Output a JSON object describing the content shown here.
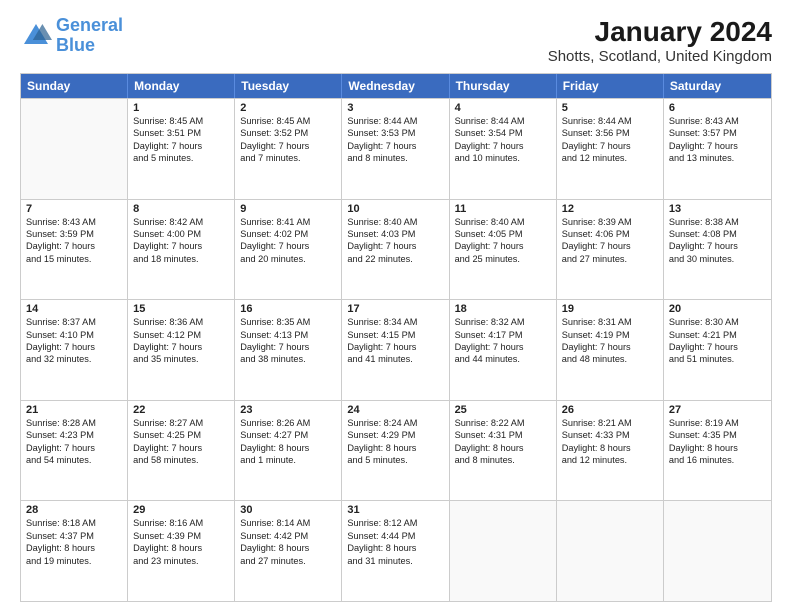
{
  "header": {
    "logo_general": "General",
    "logo_blue": "Blue",
    "main_title": "January 2024",
    "subtitle": "Shotts, Scotland, United Kingdom"
  },
  "days_of_week": [
    "Sunday",
    "Monday",
    "Tuesday",
    "Wednesday",
    "Thursday",
    "Friday",
    "Saturday"
  ],
  "weeks": [
    [
      {
        "day": "",
        "lines": []
      },
      {
        "day": "1",
        "lines": [
          "Sunrise: 8:45 AM",
          "Sunset: 3:51 PM",
          "Daylight: 7 hours",
          "and 5 minutes."
        ]
      },
      {
        "day": "2",
        "lines": [
          "Sunrise: 8:45 AM",
          "Sunset: 3:52 PM",
          "Daylight: 7 hours",
          "and 7 minutes."
        ]
      },
      {
        "day": "3",
        "lines": [
          "Sunrise: 8:44 AM",
          "Sunset: 3:53 PM",
          "Daylight: 7 hours",
          "and 8 minutes."
        ]
      },
      {
        "day": "4",
        "lines": [
          "Sunrise: 8:44 AM",
          "Sunset: 3:54 PM",
          "Daylight: 7 hours",
          "and 10 minutes."
        ]
      },
      {
        "day": "5",
        "lines": [
          "Sunrise: 8:44 AM",
          "Sunset: 3:56 PM",
          "Daylight: 7 hours",
          "and 12 minutes."
        ]
      },
      {
        "day": "6",
        "lines": [
          "Sunrise: 8:43 AM",
          "Sunset: 3:57 PM",
          "Daylight: 7 hours",
          "and 13 minutes."
        ]
      }
    ],
    [
      {
        "day": "7",
        "lines": [
          "Sunrise: 8:43 AM",
          "Sunset: 3:59 PM",
          "Daylight: 7 hours",
          "and 15 minutes."
        ]
      },
      {
        "day": "8",
        "lines": [
          "Sunrise: 8:42 AM",
          "Sunset: 4:00 PM",
          "Daylight: 7 hours",
          "and 18 minutes."
        ]
      },
      {
        "day": "9",
        "lines": [
          "Sunrise: 8:41 AM",
          "Sunset: 4:02 PM",
          "Daylight: 7 hours",
          "and 20 minutes."
        ]
      },
      {
        "day": "10",
        "lines": [
          "Sunrise: 8:40 AM",
          "Sunset: 4:03 PM",
          "Daylight: 7 hours",
          "and 22 minutes."
        ]
      },
      {
        "day": "11",
        "lines": [
          "Sunrise: 8:40 AM",
          "Sunset: 4:05 PM",
          "Daylight: 7 hours",
          "and 25 minutes."
        ]
      },
      {
        "day": "12",
        "lines": [
          "Sunrise: 8:39 AM",
          "Sunset: 4:06 PM",
          "Daylight: 7 hours",
          "and 27 minutes."
        ]
      },
      {
        "day": "13",
        "lines": [
          "Sunrise: 8:38 AM",
          "Sunset: 4:08 PM",
          "Daylight: 7 hours",
          "and 30 minutes."
        ]
      }
    ],
    [
      {
        "day": "14",
        "lines": [
          "Sunrise: 8:37 AM",
          "Sunset: 4:10 PM",
          "Daylight: 7 hours",
          "and 32 minutes."
        ]
      },
      {
        "day": "15",
        "lines": [
          "Sunrise: 8:36 AM",
          "Sunset: 4:12 PM",
          "Daylight: 7 hours",
          "and 35 minutes."
        ]
      },
      {
        "day": "16",
        "lines": [
          "Sunrise: 8:35 AM",
          "Sunset: 4:13 PM",
          "Daylight: 7 hours",
          "and 38 minutes."
        ]
      },
      {
        "day": "17",
        "lines": [
          "Sunrise: 8:34 AM",
          "Sunset: 4:15 PM",
          "Daylight: 7 hours",
          "and 41 minutes."
        ]
      },
      {
        "day": "18",
        "lines": [
          "Sunrise: 8:32 AM",
          "Sunset: 4:17 PM",
          "Daylight: 7 hours",
          "and 44 minutes."
        ]
      },
      {
        "day": "19",
        "lines": [
          "Sunrise: 8:31 AM",
          "Sunset: 4:19 PM",
          "Daylight: 7 hours",
          "and 48 minutes."
        ]
      },
      {
        "day": "20",
        "lines": [
          "Sunrise: 8:30 AM",
          "Sunset: 4:21 PM",
          "Daylight: 7 hours",
          "and 51 minutes."
        ]
      }
    ],
    [
      {
        "day": "21",
        "lines": [
          "Sunrise: 8:28 AM",
          "Sunset: 4:23 PM",
          "Daylight: 7 hours",
          "and 54 minutes."
        ]
      },
      {
        "day": "22",
        "lines": [
          "Sunrise: 8:27 AM",
          "Sunset: 4:25 PM",
          "Daylight: 7 hours",
          "and 58 minutes."
        ]
      },
      {
        "day": "23",
        "lines": [
          "Sunrise: 8:26 AM",
          "Sunset: 4:27 PM",
          "Daylight: 8 hours",
          "and 1 minute."
        ]
      },
      {
        "day": "24",
        "lines": [
          "Sunrise: 8:24 AM",
          "Sunset: 4:29 PM",
          "Daylight: 8 hours",
          "and 5 minutes."
        ]
      },
      {
        "day": "25",
        "lines": [
          "Sunrise: 8:22 AM",
          "Sunset: 4:31 PM",
          "Daylight: 8 hours",
          "and 8 minutes."
        ]
      },
      {
        "day": "26",
        "lines": [
          "Sunrise: 8:21 AM",
          "Sunset: 4:33 PM",
          "Daylight: 8 hours",
          "and 12 minutes."
        ]
      },
      {
        "day": "27",
        "lines": [
          "Sunrise: 8:19 AM",
          "Sunset: 4:35 PM",
          "Daylight: 8 hours",
          "and 16 minutes."
        ]
      }
    ],
    [
      {
        "day": "28",
        "lines": [
          "Sunrise: 8:18 AM",
          "Sunset: 4:37 PM",
          "Daylight: 8 hours",
          "and 19 minutes."
        ]
      },
      {
        "day": "29",
        "lines": [
          "Sunrise: 8:16 AM",
          "Sunset: 4:39 PM",
          "Daylight: 8 hours",
          "and 23 minutes."
        ]
      },
      {
        "day": "30",
        "lines": [
          "Sunrise: 8:14 AM",
          "Sunset: 4:42 PM",
          "Daylight: 8 hours",
          "and 27 minutes."
        ]
      },
      {
        "day": "31",
        "lines": [
          "Sunrise: 8:12 AM",
          "Sunset: 4:44 PM",
          "Daylight: 8 hours",
          "and 31 minutes."
        ]
      },
      {
        "day": "",
        "lines": []
      },
      {
        "day": "",
        "lines": []
      },
      {
        "day": "",
        "lines": []
      }
    ]
  ]
}
